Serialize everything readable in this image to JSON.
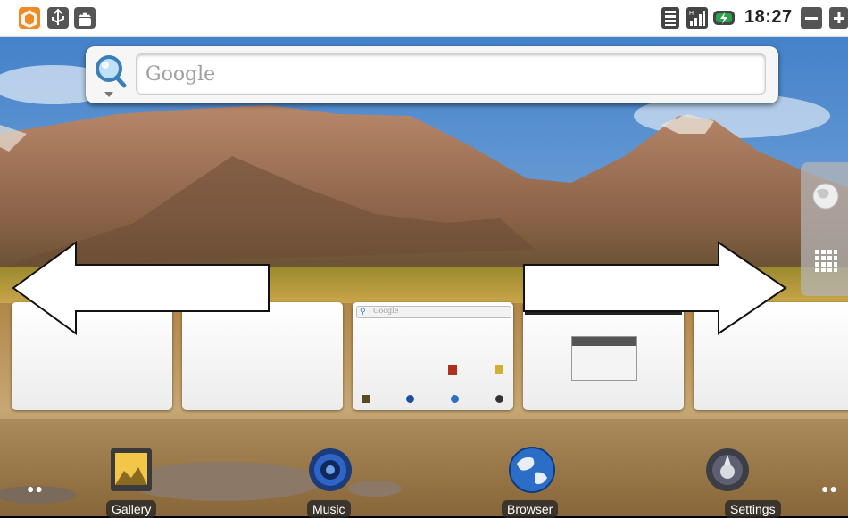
{
  "status_bar": {
    "left_icons": [
      "home-icon",
      "usb-icon",
      "android-debug-icon"
    ],
    "right_icons": [
      "wifi-signal-icon",
      "cell-signal-icon",
      "battery-charging-icon",
      "volume-down-icon",
      "volume-up-icon"
    ],
    "clock": "18:27"
  },
  "search": {
    "placeholder": "Google",
    "icon": "search-icon"
  },
  "side_handle": {
    "icons": [
      "globe-icon",
      "app-grid-icon"
    ]
  },
  "screens": {
    "count": 5,
    "current_index": 2,
    "mini_search_text": "Google"
  },
  "navigation_arrows": [
    "left-arrow",
    "right-arrow"
  ],
  "dock": {
    "items": [
      {
        "label": "Gallery",
        "icon": "gallery-icon"
      },
      {
        "label": "Music",
        "icon": "music-icon"
      },
      {
        "label": "Browser",
        "icon": "browser-globe-icon"
      },
      {
        "label": "Settings",
        "icon": "settings-icon"
      }
    ]
  },
  "colors": {
    "status_bar_bg": "#ffffff",
    "accent_orange": "#f08a24",
    "sky": "#4f8fd1",
    "lake": "#b58a4a"
  }
}
